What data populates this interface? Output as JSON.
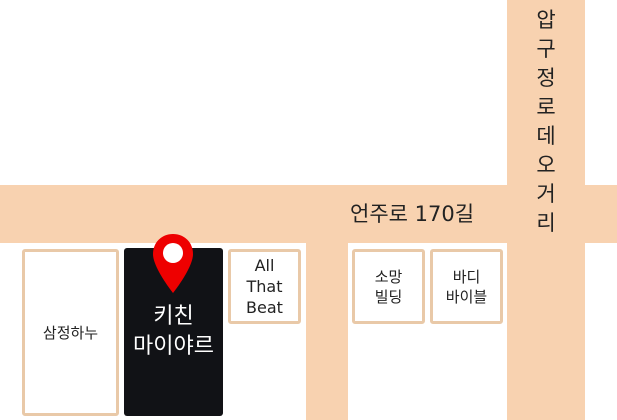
{
  "roads": {
    "horizontal_label": "언주로 170길",
    "vertical_label_chars": [
      "압",
      "구",
      "정",
      "로",
      "데",
      "오",
      "거",
      "리"
    ]
  },
  "buildings": {
    "samjeong": "삼정하누",
    "kitchen": "키친\n마이야르",
    "allthat": "All\nThat\nBeat",
    "somang": "소망\n빌딩",
    "badi": "바디\n바이블"
  },
  "marker": {
    "color": "#ee0000",
    "icon": "location-pin-icon"
  },
  "colors": {
    "road": "#f8d2b0",
    "building_border": "#e9c9a8",
    "highlight": "#111216"
  }
}
